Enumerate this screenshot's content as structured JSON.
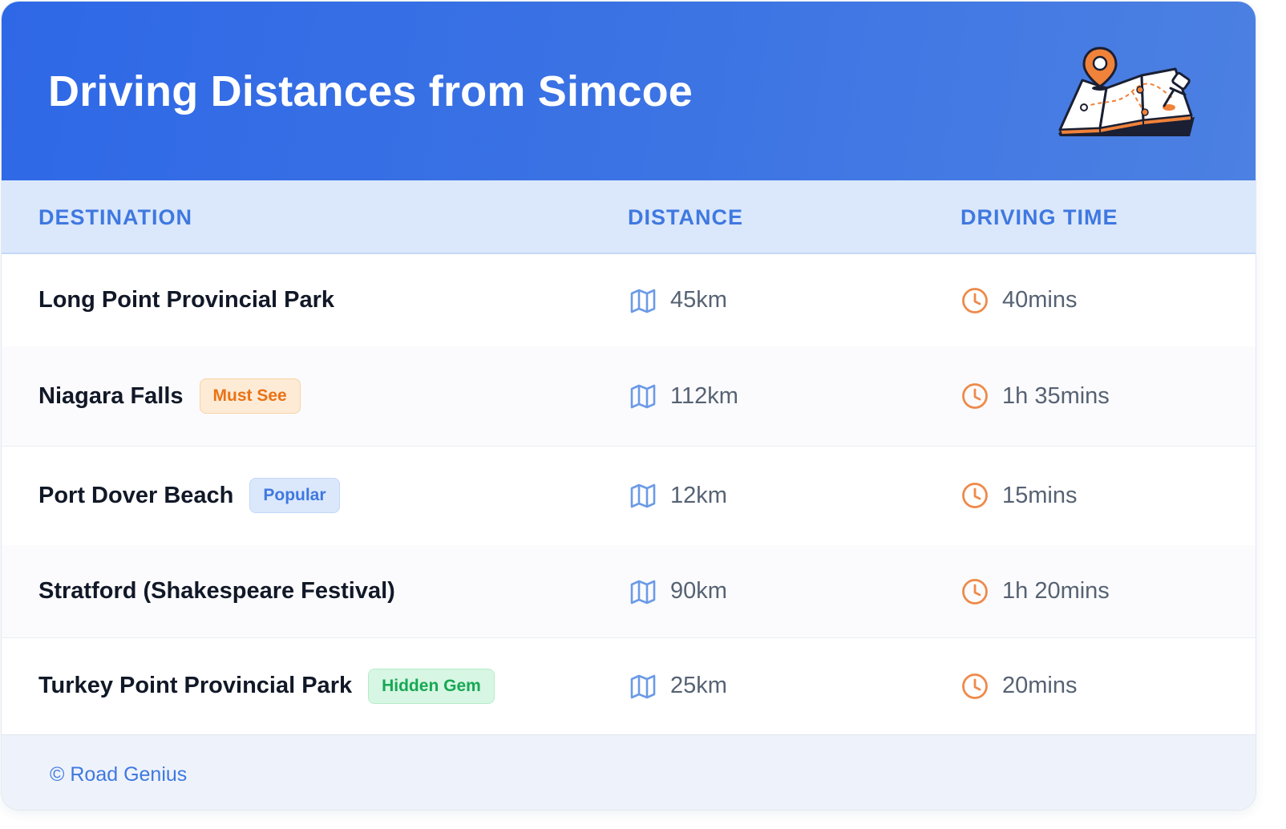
{
  "header": {
    "title": "Driving Distances from Simcoe",
    "illustration_icon": "map-with-pins-icon"
  },
  "table": {
    "columns": [
      "DESTINATION",
      "DISTANCE",
      "DRIVING TIME"
    ],
    "distance_icon": "map-icon",
    "time_icon": "clock-icon",
    "rows": [
      {
        "destination": "Long Point Provincial Park",
        "badge": "",
        "distance": "45km",
        "time": "40mins"
      },
      {
        "destination": "Niagara Falls",
        "badge": "Must See",
        "distance": "112km",
        "time": "1h 35mins"
      },
      {
        "destination": "Port Dover Beach",
        "badge": "Popular",
        "distance": "12km",
        "time": "15mins"
      },
      {
        "destination": "Stratford (Shakespeare Festival)",
        "badge": "",
        "distance": "90km",
        "time": "1h 20mins"
      },
      {
        "destination": "Turkey Point Provincial Park",
        "badge": "Hidden Gem",
        "distance": "25km",
        "time": "20mins"
      }
    ]
  },
  "badge_styles": {
    "Must See": {
      "bg": "#fdebd6",
      "border": "#f9d2a8",
      "color": "#ea7215"
    },
    "Popular": {
      "bg": "#dbe8fc",
      "border": "#c2d7f7",
      "color": "#3f78e0"
    },
    "Hidden Gem": {
      "bg": "#d7f6e3",
      "border": "#b6ecc9",
      "color": "#17a854"
    }
  },
  "colors": {
    "header_bg": "#3370e5",
    "accent_blue": "#3f78e0",
    "accent_orange": "#ee8a4a",
    "map_icon": "#6b9ae6"
  },
  "footer": {
    "text": "© Road Genius"
  }
}
